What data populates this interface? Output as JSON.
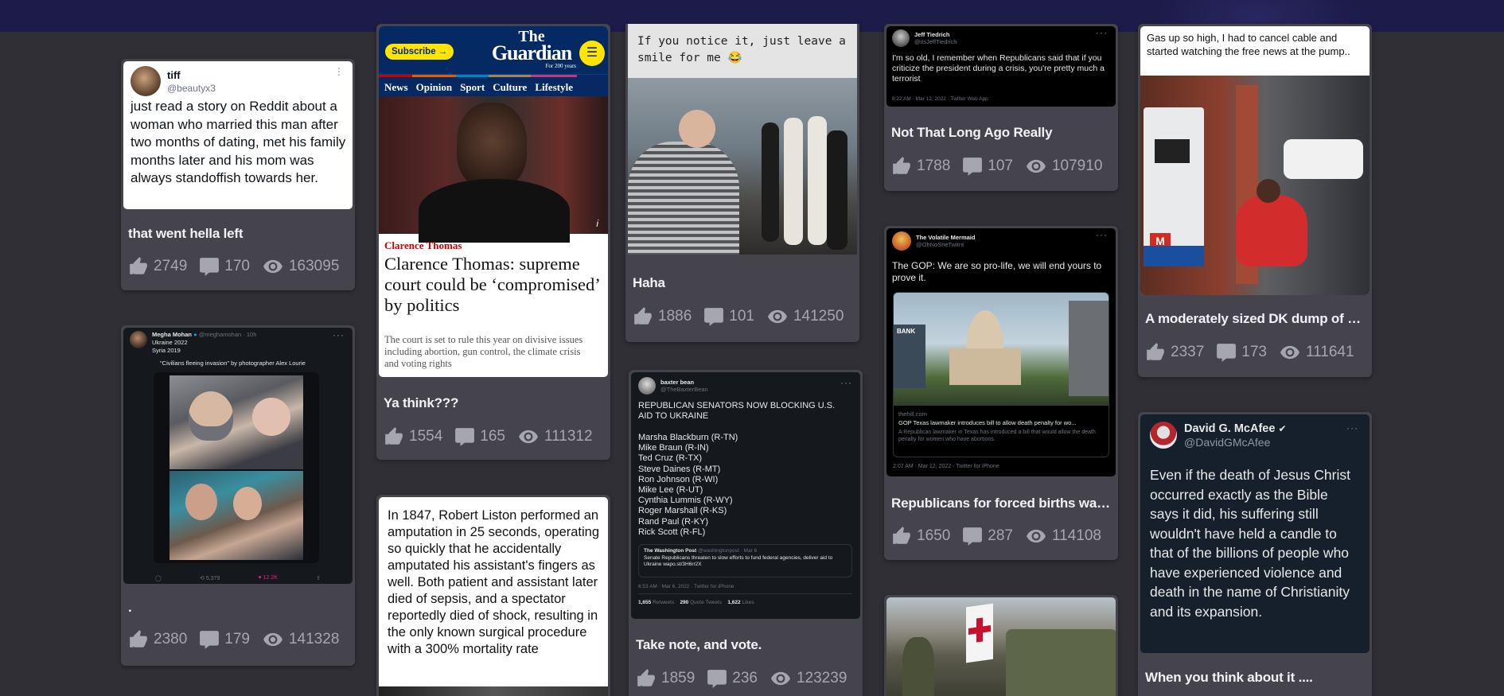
{
  "cards": [
    {
      "title": "that went hella left",
      "likes": "2749",
      "comments": "170",
      "views": "163095",
      "tweet": {
        "name": "tiff",
        "handle": "@beautyx3",
        "text": "just read a story on Reddit about a woman who married this man after two months of dating, met his family months later and his mom was always standoffish towards her."
      }
    },
    {
      "title": ".",
      "likes": "2380",
      "comments": "179",
      "views": "141328",
      "tweet": {
        "name": "Megha Mohan",
        "handle": "@meghamohan · 10h",
        "line1": "Ukraine 2022",
        "line2": "Syria 2019",
        "caption": "\"Civilians fleeing invasion\" by photographer Alex Lourie",
        "retweets": "5,379",
        "likes": "12.2K"
      }
    },
    {
      "title": "Ya think???",
      "likes": "1554",
      "comments": "165",
      "views": "111312",
      "guardian": {
        "subscribe": "Subscribe",
        "logo_line1": "The",
        "logo_line2": "Guardian",
        "logo_sub": "For 200 years",
        "nav": [
          "News",
          "Opinion",
          "Sport",
          "Culture",
          "Lifestyle"
        ],
        "kicker": "Clarence Thomas",
        "headline": "Clarence Thomas: supreme court could be ‘compromised’ by politics",
        "standfirst": "The court is set to rule this year on divisive issues including abortion, gun control, the climate crisis and voting rights",
        "info": "i"
      }
    },
    {
      "text": "In 1847, Robert Liston performed an amputation in 25 seconds, operating so quickly that he accidentally amputated his assistant's fingers as well. Both patient and assistant later died of sepsis, and a spectator reportedly died of shock, resulting in the only known surgical procedure with a 300% mortality rate"
    },
    {
      "title": "Haha",
      "likes": "1886",
      "comments": "101",
      "views": "141250",
      "meme_caption": "If you notice it, just leave a smile for me 😂"
    },
    {
      "title": "Take note, and vote.",
      "likes": "1859",
      "comments": "236",
      "views": "123239",
      "tweet": {
        "name": "baxter bean",
        "handle": "@TheBaxterBean",
        "headline": "REPUBLICAN SENATORS NOW BLOCKING U.S. AID TO UKRAINE",
        "senators": [
          "Marsha Blackburn (R-TN)",
          "Mike Braun (R-IN)",
          "Ted Cruz (R-TX)",
          "Steve Daines (R-MT)",
          "Ron Johnson (R-WI)",
          "Mike Lee (R-UT)",
          "Cynthia Lummis (R-WY)",
          "Roger Marshall (R-KS)",
          "Rand Paul (R-KY)",
          "Rick Scott (R-FL)"
        ],
        "quote_name": "The Washington Post",
        "quote_handle": "@washingtonpost · Mar 6",
        "quote_text": "Senate Republicans threaten to slow efforts to fund federal agencies, deliver aid to Ukraine wapo.st/3H6rr2X",
        "meta": "6:53 AM · Mar 6, 2022 · Twitter for iPhone",
        "retweets": "1,655",
        "retweets_label": "Retweets",
        "quotes": "290",
        "quotes_label": "Quote Tweets",
        "likes": "1,622",
        "likes_label": "Likes"
      }
    },
    {
      "title": "Not That Long Ago Really",
      "likes": "1788",
      "comments": "107",
      "views": "107910",
      "tweet": {
        "name": "Jeff Tiedrich",
        "handle": "@itsJeffTiedrich",
        "text": "I'm so old, I remember when Republicans said that if you criticize the president during a crisis, you're pretty much a terrorist",
        "meta": "8:22 AM · Mar 12, 2022 · Twitter Web App"
      }
    },
    {
      "title": "Republicans for forced births want...",
      "likes": "1650",
      "comments": "287",
      "views": "114108",
      "tweet": {
        "name": "The Volatile Mermaid",
        "handle": "@OhNoSheTwitnt",
        "text": "The GOP: We are so pro-life, we will end yours to prove it.",
        "link_domain": "thehill.com",
        "link_title": "GOP Texas lawmaker introduces bill to allow death penalty for wo...",
        "link_desc": "A Republican lawmaker in Texas has introduced a bill that would allow the death penalty for women who have abortions.",
        "meta": "2:07 AM · Mar 12, 2022 · Twitter for iPhone",
        "bank_sign": "BANK"
      }
    },
    {
      "title": "A moderately sized DK dump of st...",
      "likes": "2337",
      "comments": "173",
      "views": "111641",
      "caption": "Gas up so high, I had to cancel cable and started watching the free news at the pump.."
    },
    {
      "title": "When you think about it ....",
      "tweet": {
        "name": "David G. McAfee",
        "handle": "@DavidGMcAfee",
        "text": "Even if the death of Jesus Christ occurred exactly as the Bible says it did, his suffering still wouldn't have held a candle to that of the billions of people who have experienced violence and death in the name of Christianity and its expansion."
      }
    }
  ],
  "colors": {
    "background": "#2f2f35",
    "card": "#45444c",
    "topbar": "#1d1b49",
    "guardian_blue": "#052962",
    "guardian_yellow": "#ffe500"
  },
  "icons": [
    "thumbs-up-icon",
    "comment-icon",
    "eye-icon"
  ]
}
